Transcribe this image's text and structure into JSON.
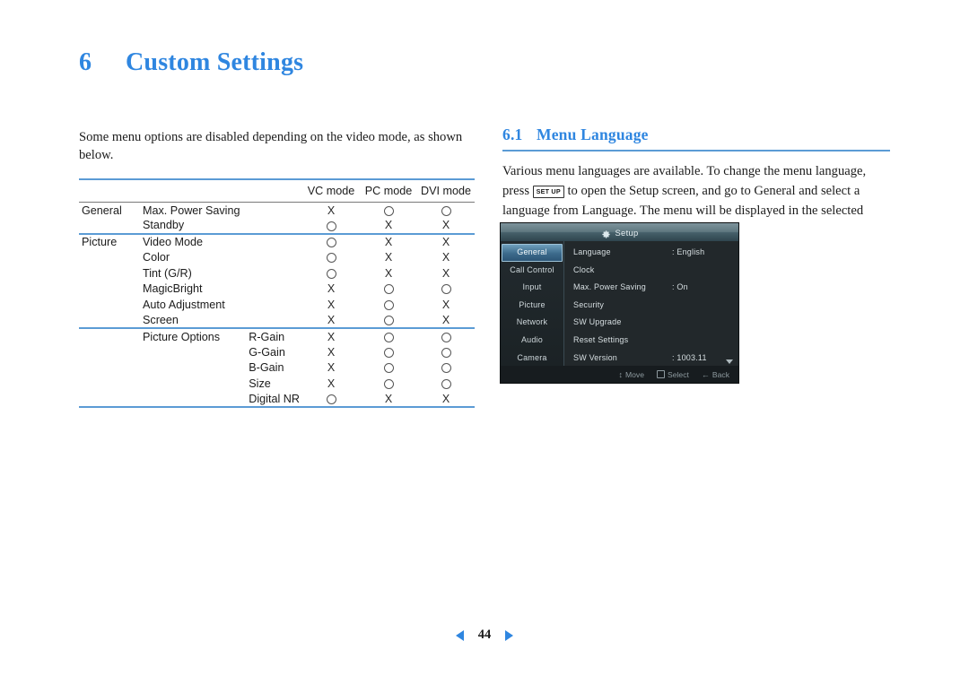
{
  "chapter": {
    "number": "6",
    "title": "Custom Settings"
  },
  "left": {
    "intro": "Some menu options are disabled depending on the video mode, as shown below.",
    "table": {
      "headers": [
        "",
        "",
        "",
        "VC mode",
        "PC mode",
        "DVI mode"
      ],
      "col_headers": [
        "VC mode",
        "PC mode",
        "DVI mode"
      ],
      "groups": [
        {
          "group": "General",
          "rows": [
            {
              "option": "Max. Power Saving",
              "sub": "",
              "vc": "X",
              "pc": "O",
              "dvi": "O"
            },
            {
              "option": "Standby",
              "sub": "",
              "vc": "O",
              "pc": "X",
              "dvi": "X"
            }
          ]
        },
        {
          "group": "Picture",
          "rows": [
            {
              "option": "Video Mode",
              "sub": "",
              "vc": "O",
              "pc": "X",
              "dvi": "X"
            },
            {
              "option": "Color",
              "sub": "",
              "vc": "O",
              "pc": "X",
              "dvi": "X"
            },
            {
              "option": "Tint (G/R)",
              "sub": "",
              "vc": "O",
              "pc": "X",
              "dvi": "X"
            },
            {
              "option": "MagicBright",
              "sub": "",
              "vc": "X",
              "pc": "O",
              "dvi": "O"
            },
            {
              "option": "Auto Adjustment",
              "sub": "",
              "vc": "X",
              "pc": "O",
              "dvi": "X"
            },
            {
              "option": "Screen",
              "sub": "",
              "vc": "X",
              "pc": "O",
              "dvi": "X"
            }
          ]
        },
        {
          "group": "",
          "rows": [
            {
              "option": "Picture Options",
              "sub": "R-Gain",
              "vc": "X",
              "pc": "O",
              "dvi": "O"
            },
            {
              "option": "",
              "sub": "G-Gain",
              "vc": "X",
              "pc": "O",
              "dvi": "O"
            },
            {
              "option": "",
              "sub": "B-Gain",
              "vc": "X",
              "pc": "O",
              "dvi": "O"
            },
            {
              "option": "",
              "sub": "Size",
              "vc": "X",
              "pc": "O",
              "dvi": "O"
            },
            {
              "option": "",
              "sub": "Digital NR",
              "vc": "O",
              "pc": "X",
              "dvi": "X"
            }
          ]
        }
      ]
    }
  },
  "right": {
    "section": {
      "number": "6.1",
      "title": "Menu Language"
    },
    "paragraph_part1": "Various menu languages are available.  To change the menu language, press",
    "key_label": "SET UP",
    "paragraph_part2": "to open the Setup screen, and go to General and select a language from Language. The menu will be displayed in the selected language."
  },
  "osd": {
    "title": "Setup",
    "nav_items": [
      {
        "label": "General",
        "active": true
      },
      {
        "label": "Call Control",
        "active": false
      },
      {
        "label": "Input",
        "active": false
      },
      {
        "label": "Picture",
        "active": false
      },
      {
        "label": "Network",
        "active": false
      },
      {
        "label": "Audio",
        "active": false
      },
      {
        "label": "Camera",
        "active": false
      }
    ],
    "rows": [
      {
        "label": "Language",
        "value": ": English"
      },
      {
        "label": "Clock",
        "value": ""
      },
      {
        "label": "Max. Power Saving",
        "value": ": On"
      },
      {
        "label": "Security",
        "value": ""
      },
      {
        "label": "SW Upgrade",
        "value": ""
      },
      {
        "label": "Reset Settings",
        "value": ""
      },
      {
        "label": "SW Version",
        "value": ": 1003.11"
      }
    ],
    "status": [
      {
        "label": "Move"
      },
      {
        "label": "Select"
      },
      {
        "label": "Back"
      }
    ]
  },
  "footer": {
    "page_number": "44"
  },
  "colors": {
    "accent_blue": "#2f86e0",
    "rule_blue": "#5b9bd5",
    "text": "#1c1c1c"
  }
}
